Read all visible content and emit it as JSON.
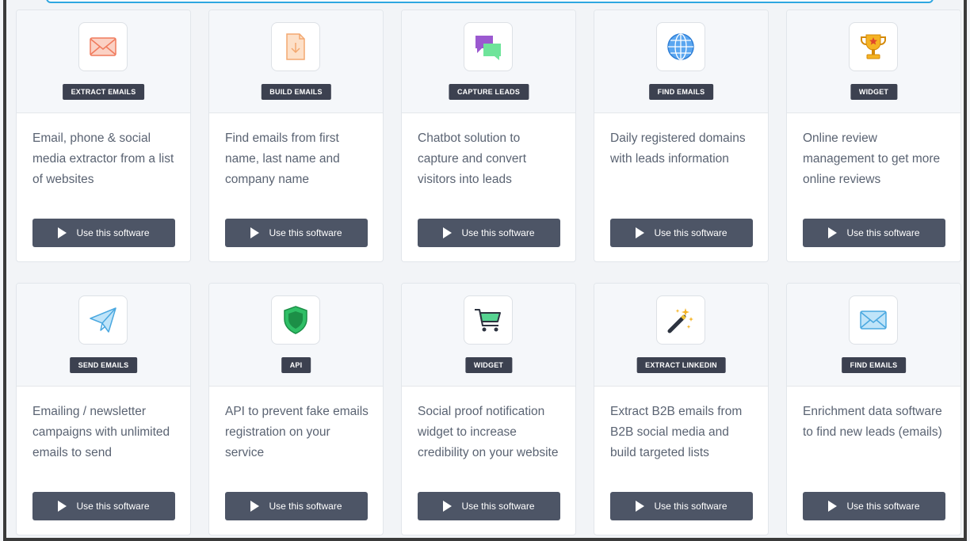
{
  "button_label": "Use this software",
  "cards": [
    {
      "icon": "envelope-icon",
      "tag": "EXTRACT EMAILS",
      "desc": "Email, phone & social media extractor from a list of websites"
    },
    {
      "icon": "document-download-icon",
      "tag": "BUILD EMAILS",
      "desc": "Find emails from first name, last name and company name"
    },
    {
      "icon": "chat-bubbles-icon",
      "tag": "CAPTURE LEADS",
      "desc": "Chatbot solution to capture and convert visitors into leads"
    },
    {
      "icon": "globe-icon",
      "tag": "FIND EMAILS",
      "desc": "Daily registered domains with leads information"
    },
    {
      "icon": "trophy-icon",
      "tag": "WIDGET",
      "desc": "Online review management to get more online reviews"
    },
    {
      "icon": "paper-plane-icon",
      "tag": "SEND EMAILS",
      "desc": "Emailing / newsletter campaigns with unlimited emails to send"
    },
    {
      "icon": "shield-icon",
      "tag": "API",
      "desc": "API to prevent fake emails registration on your service"
    },
    {
      "icon": "cart-icon",
      "tag": "WIDGET",
      "desc": "Social proof notification widget to increase credibility on your website"
    },
    {
      "icon": "magic-wand-icon",
      "tag": "EXTRACT LINKEDIN",
      "desc": "Extract B2B emails from B2B social media and build targeted lists"
    },
    {
      "icon": "envelope-blue-icon",
      "tag": "FIND EMAILS",
      "desc": "Enrichment data software to find new leads (emails)"
    }
  ]
}
